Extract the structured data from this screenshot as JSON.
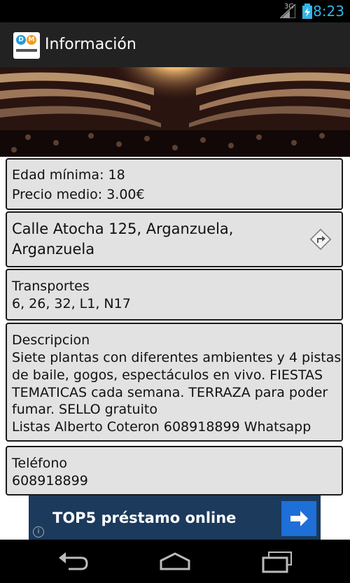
{
  "status": {
    "network": "3G",
    "time": "8:23",
    "accent": "#33b5e5"
  },
  "actionbar": {
    "title": "Información",
    "logo_icon": "app-logo-icon"
  },
  "info": {
    "edad_label": "Edad mínima: 18",
    "precio_label": "Precio medio: 3.00€"
  },
  "address": {
    "line1": "Calle Atocha 125, Arganzuela,",
    "line2": "Arganzuela",
    "icon": "directions-icon"
  },
  "transportes": {
    "heading": "Transportes",
    "value": " 6, 26, 32, L1, N17"
  },
  "descripcion": {
    "heading": "Descripcion",
    "lines": [
      " Siete plantas con diferentes ambientes y 4 pistas",
      "de baile, gogos, espectáculos en vivo. FIESTAS",
      "TEMATICAS cada semana. TERRAZA para poder",
      "fumar. SELLO gratuito",
      "Listas Alberto Coteron 608918899 Whatsapp"
    ]
  },
  "telefono": {
    "heading": "Teléfono",
    "value": " 608918899"
  },
  "ad": {
    "text": "TOP5 préstamo online",
    "button_icon": "arrow-right-icon",
    "info_icon": "info-icon"
  },
  "navbar": {
    "back_icon": "back-icon",
    "home_icon": "home-icon",
    "recents_icon": "recents-icon"
  }
}
